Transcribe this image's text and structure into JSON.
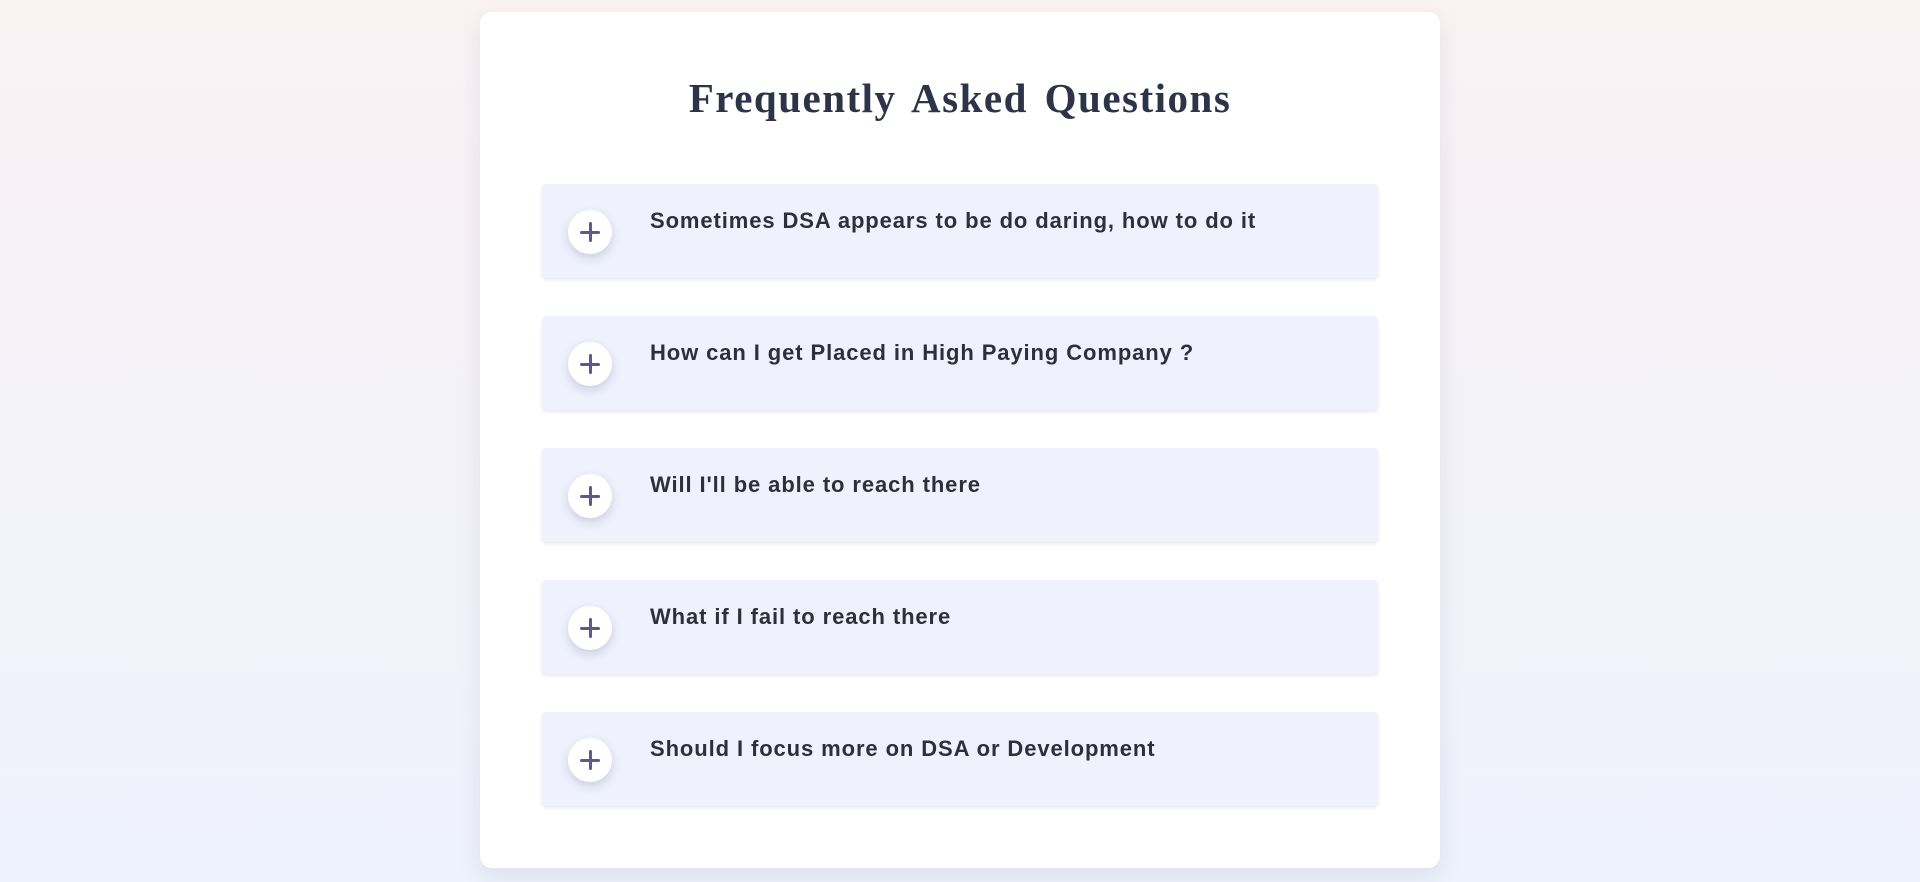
{
  "page": {
    "title": "Frequently Asked Questions"
  },
  "faq": {
    "items": [
      {
        "question": "Sometimes DSA appears to be do daring, how to do it",
        "icon": "plus-icon",
        "expanded": false
      },
      {
        "question": "How can I get Placed in High Paying Company ?",
        "icon": "plus-icon",
        "expanded": false
      },
      {
        "question": "Will I'll be able to reach there",
        "icon": "plus-icon",
        "expanded": false
      },
      {
        "question": "What if I fail to reach there",
        "icon": "plus-icon",
        "expanded": false
      },
      {
        "question": "Should I focus more on DSA or Development",
        "icon": "plus-icon",
        "expanded": false
      }
    ]
  },
  "colors": {
    "title_text": "#2d3448",
    "item_background": "#eff2fd",
    "icon_color": "#5d5890",
    "question_text": "#2d2f3a"
  }
}
